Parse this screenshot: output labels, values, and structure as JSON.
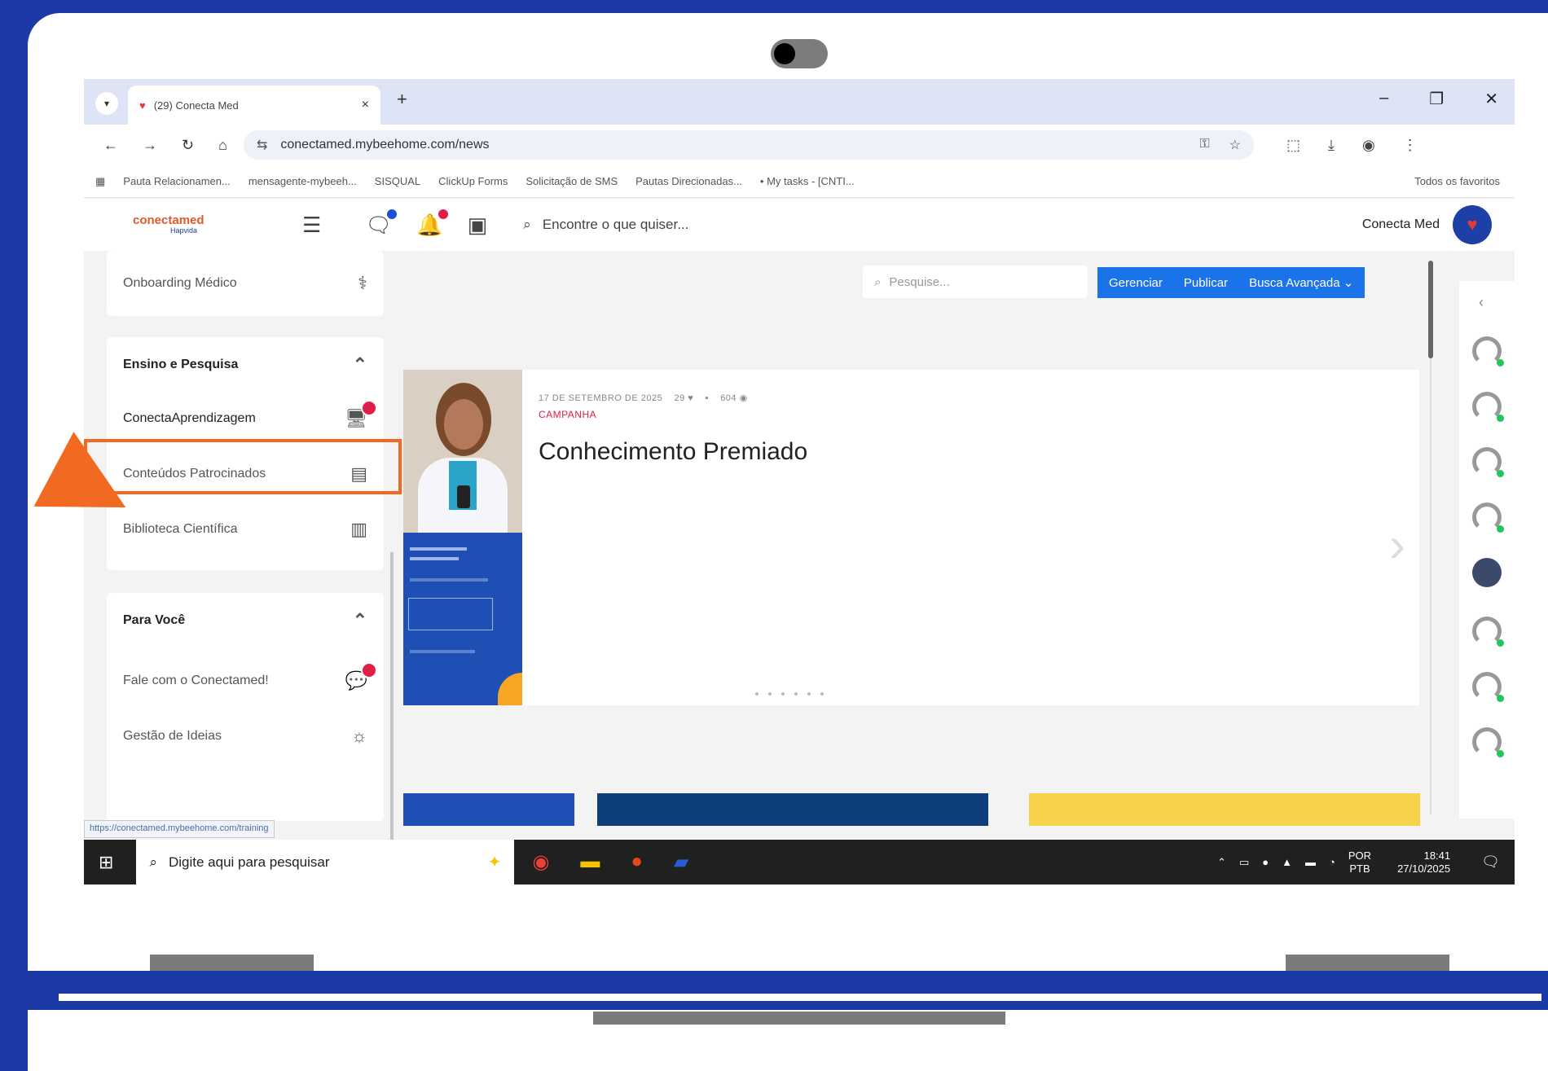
{
  "browser": {
    "tab_title": "(29) Conecta Med",
    "url": "conectamed.mybeehome.com/news",
    "bookmarks": [
      "Pauta Relacionamen...",
      "mensagente-mybeeh...",
      "SISQUAL",
      "ClickUp Forms",
      "Solicitação de SMS",
      "Pautas Direcionadas...",
      "• My tasks - [CNTI..."
    ],
    "bookmarks_right": "Todos os favoritos"
  },
  "app": {
    "logo_name": "conectamed",
    "logo_sub": "Hapvida",
    "search_placeholder": "Encontre o que quiser...",
    "user_name": "Conecta Med"
  },
  "sidebar": {
    "onboarding": "Onboarding Médico",
    "section1_title": "Ensino e Pesquisa",
    "section1_items": [
      "ConectaAprendizagem",
      "Conteúdos Patrocinados",
      "Biblioteca Científica"
    ],
    "section2_title": "Para Você",
    "section2_items": [
      "Fale com o Conectamed!",
      "Gestão de Ideias"
    ]
  },
  "main": {
    "search_placeholder": "Pesquise...",
    "actions": [
      "Gerenciar",
      "Publicar",
      "Busca Avançada"
    ],
    "banner": {
      "date": "17 DE SETEMBRO DE 2025",
      "stats": [
        "29",
        "604"
      ],
      "tag": "CAMPANHA",
      "title": "Conhecimento Premiado"
    }
  },
  "status_url": "https://conectamed.mybeehome.com/training",
  "taskbar": {
    "search_placeholder": "Digite aqui para pesquisar",
    "lang1": "POR",
    "lang2": "PTB",
    "time": "18:41",
    "date": "27/10/2025"
  },
  "colors": {
    "frame_blue": "#1b3aa6",
    "highlight_orange": "#f26a21",
    "action_blue": "#1a73e8",
    "badge_red": "#e11d48"
  }
}
